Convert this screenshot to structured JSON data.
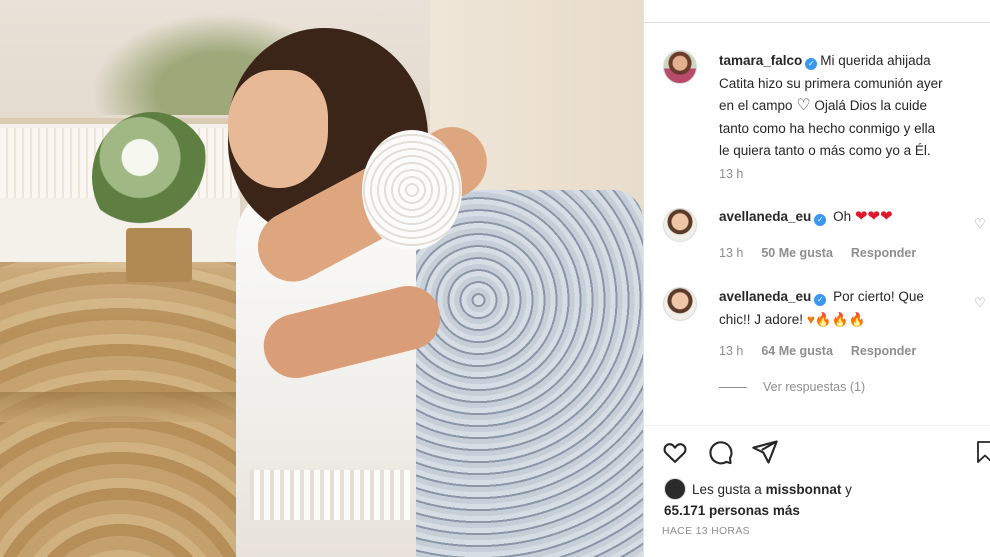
{
  "post": {
    "author": "tamara_falco",
    "caption_lines": [
      "Mi querida ahijada",
      "Catita hizo su primera comunión ayer",
      "en el campo",
      "Ojalá Dios la cuide",
      "tanto como ha hecho conmigo y ella",
      "le quiera tanto o más como yo a Él."
    ],
    "age": "13 h"
  },
  "comments": [
    {
      "user": "avellaneda_eu",
      "text": "Oh",
      "emojis": "❤❤❤",
      "age": "13 h",
      "likes": "50 Me gusta",
      "reply": "Responder"
    },
    {
      "user": "avellaneda_eu",
      "line1": "Por cierto! Que",
      "line2": "chic!! J adore!",
      "emojis": "♥🔥🔥🔥",
      "age": "13 h",
      "likes": "64 Me gusta",
      "reply": "Responder"
    }
  ],
  "view_replies": "Ver respuestas (1)",
  "likes_text": {
    "prefix": "Les gusta a",
    "user": "missbonnat",
    "suffix": "y",
    "count": "65.171 personas más"
  },
  "timestamp": "HACE 13 HORAS",
  "icons": {
    "like": "heart-icon",
    "comment": "comment-icon",
    "share": "send-icon",
    "save": "bookmark-icon",
    "verified": "verified-badge-icon"
  },
  "colors": {
    "verified": "#3897f0",
    "muted_text": "#8e8e8e",
    "heart_emoji": "#e0162b"
  }
}
